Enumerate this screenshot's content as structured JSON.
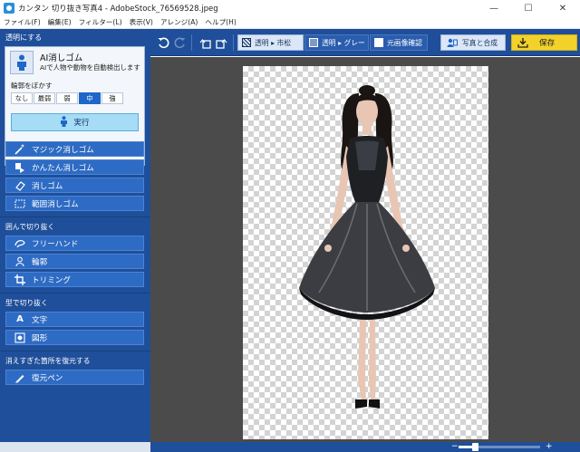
{
  "window": {
    "title": "カンタン 切り抜き写真4 - AdobeStock_76569528.jpeg",
    "minimize": "—",
    "maximize": "☐",
    "close": "✕"
  },
  "menu": [
    "ファイル(F)",
    "編集(E)",
    "フィルター(L)",
    "表示(V)",
    "アレンジ(A)",
    "ヘルプ(H)"
  ],
  "sidebar": {
    "section_transparent": "透明にする",
    "ai": {
      "title": "AI消しゴム",
      "description": "AIで人物や動物を自動検出します",
      "blur_label": "輪郭をぼかす",
      "blur_options": [
        "なし",
        "最弱",
        "弱",
        "中",
        "強"
      ],
      "blur_selected": "中",
      "execute": "実行"
    },
    "erase_tools": [
      "マジック消しゴム",
      "かんたん消しゴム",
      "消しゴム",
      "範囲消しゴム"
    ],
    "group_enclose": "囲んで切り抜く",
    "enclose_tools": [
      "フリーハンド",
      "輪郭",
      "トリミング"
    ],
    "group_shape": "型で切り抜く",
    "shape_tools": [
      "文字",
      "図形"
    ],
    "group_restore": "消えすぎた箇所を復元する",
    "restore_tools": [
      "復元ペン"
    ]
  },
  "toolbar": {
    "bg_checker": "透明 ▸ 市松",
    "bg_gray": "透明 ▸ グレー",
    "original": "元画像確認",
    "merge": "写真と合成",
    "save": "保存"
  },
  "status": {
    "zoom_fraction": 0.2
  },
  "icons": {
    "undo": "undo-icon",
    "redo": "redo-icon",
    "rotate_left": "rotate-left-icon",
    "rotate_right": "rotate-right-icon"
  },
  "colors": {
    "panel": "#1f4f9a",
    "tool_button": "#2e6bc4",
    "selected": "#1d67c9",
    "save": "#f2d12b"
  }
}
